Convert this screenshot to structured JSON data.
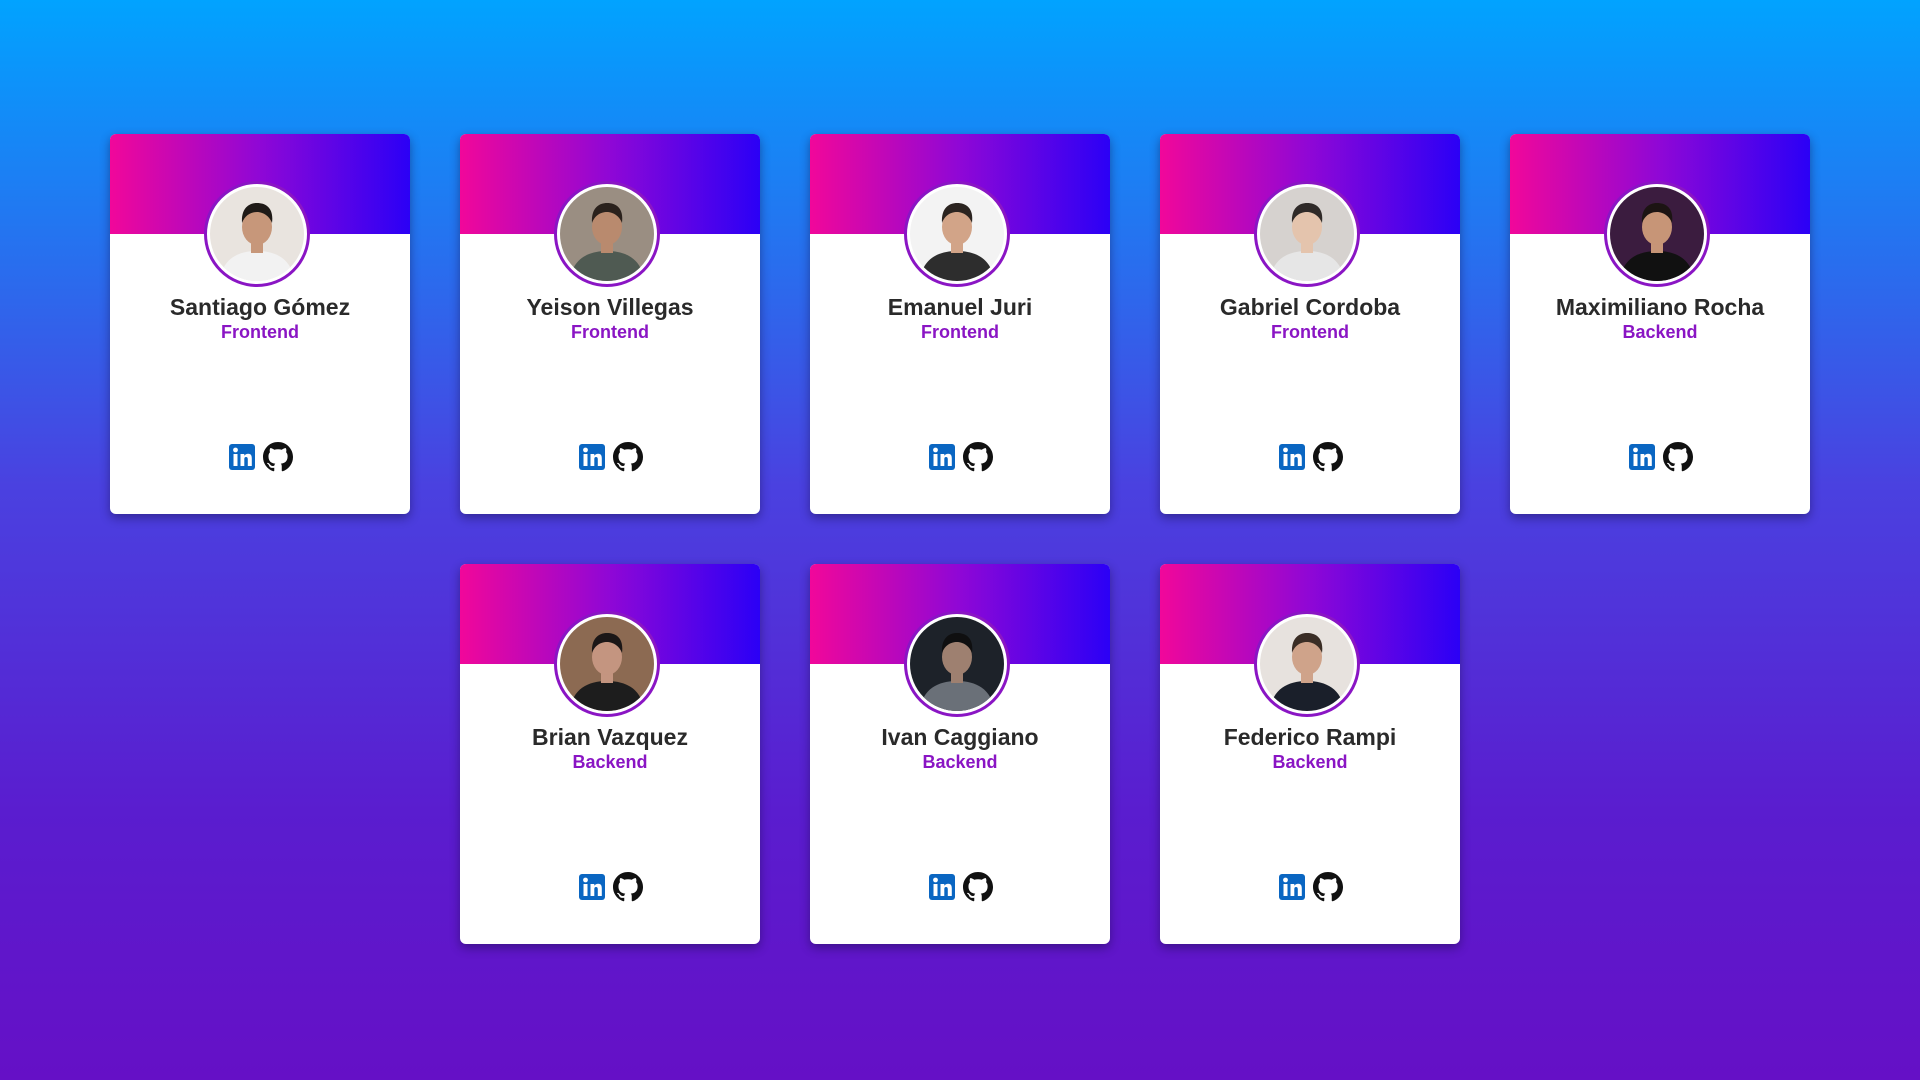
{
  "team": {
    "members": [
      {
        "name": "Santiago Gómez",
        "role": "Frontend",
        "bg": "#e9e4df",
        "skin": "#c7977a",
        "hair": "#1f1a17",
        "shirt": "#f2f2f2"
      },
      {
        "name": "Yeison Villegas",
        "role": "Frontend",
        "bg": "#9a8e82",
        "skin": "#b98a6e",
        "hair": "#2a211c",
        "shirt": "#4f5a52"
      },
      {
        "name": "Emanuel Juri",
        "role": "Frontend",
        "bg": "#f3f3f3",
        "skin": "#d2a488",
        "hair": "#2b2420",
        "shirt": "#2d2d2d"
      },
      {
        "name": "Gabriel Cordoba",
        "role": "Frontend",
        "bg": "#d6d2cf",
        "skin": "#e4c4ad",
        "hair": "#2f2a28",
        "shirt": "#e6e6e6"
      },
      {
        "name": "Maximiliano Rocha",
        "role": "Backend",
        "bg": "#3b1c3f",
        "skin": "#c79577",
        "hair": "#1c1413",
        "shirt": "#111111"
      },
      {
        "name": "Brian Vazquez",
        "role": "Backend",
        "bg": "#8c6a52",
        "skin": "#c49580",
        "hair": "#1b1717",
        "shirt": "#1d1d1d"
      },
      {
        "name": "Ivan Caggiano",
        "role": "Backend",
        "bg": "#1d2229",
        "skin": "#9e8070",
        "hair": "#0f0f10",
        "shirt": "#6a7078"
      },
      {
        "name": "Federico Rampi",
        "role": "Backend",
        "bg": "#e7e2de",
        "skin": "#cfa38a",
        "hair": "#3a2d25",
        "shirt": "#1a1f2a"
      }
    ],
    "icons": {
      "linkedin": "linkedin-icon",
      "github": "github-icon"
    }
  },
  "colors": {
    "background_top": "#01a3ff",
    "background_bottom": "#6510c6",
    "header_left": "#f1079a",
    "header_right": "#2b00f6",
    "role_color": "#8a15c4",
    "linkedin_blue": "#0a66c2"
  }
}
